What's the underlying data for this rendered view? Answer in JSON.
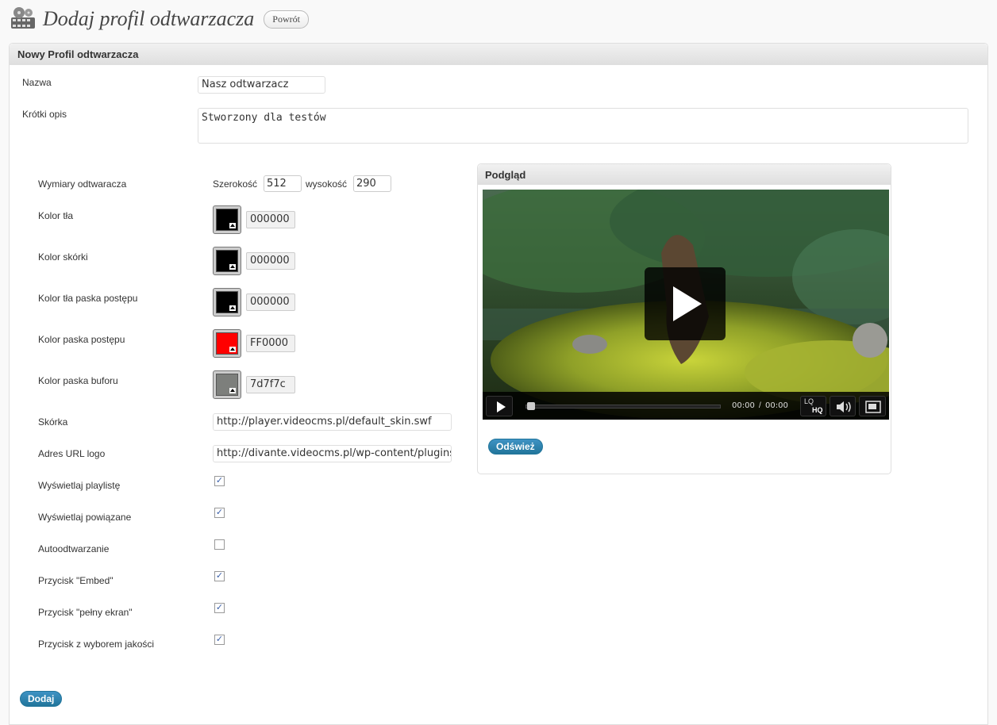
{
  "header": {
    "title": "Dodaj profil odtwarzacza",
    "back_label": "Powrót"
  },
  "box_title": "Nowy Profil odtwarzacza",
  "fields": {
    "name_label": "Nazwa",
    "name_value": "Nasz odtwarzacz",
    "desc_label": "Krótki opis",
    "desc_value": "Stworzony dla testów",
    "dims_label": "Wymiary odtwaracza",
    "width_label": "Szerokość",
    "width_value": "512",
    "height_label": "wysokość",
    "height_value": "290",
    "skin_label": "Skórka",
    "skin_value": "http://player.videocms.pl/default_skin.swf",
    "logo_label": "Adres URL logo",
    "logo_value": "http://divante.videocms.pl/wp-content/plugins"
  },
  "colors": [
    {
      "label": "Kolor tła",
      "value": "000000",
      "hex": "#000000"
    },
    {
      "label": "Kolor skórki",
      "value": "000000",
      "hex": "#000000"
    },
    {
      "label": "Kolor tła paska postępu",
      "value": "000000",
      "hex": "#000000"
    },
    {
      "label": "Kolor paska postępu",
      "value": "FF0000",
      "hex": "#FF0000"
    },
    {
      "label": "Kolor paska buforu",
      "value": "7d7f7c",
      "hex": "#7d7f7c"
    }
  ],
  "checkboxes": [
    {
      "label": "Wyświetlaj playlistę",
      "checked": true
    },
    {
      "label": "Wyświetlaj powiązane",
      "checked": true
    },
    {
      "label": "Autoodtwarzanie",
      "checked": false
    },
    {
      "label": "Przycisk \"Embed\"",
      "checked": true
    },
    {
      "label": "Przycisk \"pełny ekran\"",
      "checked": true
    },
    {
      "label": "Przycisk z wyborem jakości",
      "checked": true
    }
  ],
  "preview": {
    "title": "Podgląd",
    "time_current": "00:00",
    "time_sep": "/",
    "time_total": "00:00",
    "quality_lo": "LQ",
    "quality_hq": "HQ",
    "refresh_label": "Odśwież"
  },
  "submit_label": "Dodaj",
  "accent_color": "#21759b"
}
